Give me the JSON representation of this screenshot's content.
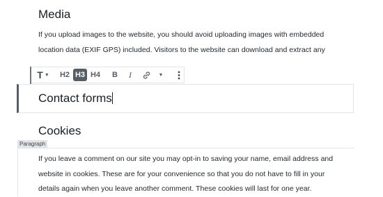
{
  "media": {
    "heading": "Media",
    "lines": [
      "If you upload images to the website, you should avoid uploading images with embedded",
      "location data (EXIF GPS) included. Visitors to the website can download and extract any"
    ]
  },
  "toolbar": {
    "transform_icon": "T",
    "h2": "H2",
    "h3": "H3",
    "h4": "H4",
    "bold": "B",
    "italic": "I"
  },
  "selected_block": {
    "text": "Contact forms"
  },
  "cookies": {
    "heading": "Cookies",
    "block_label": "Paragraph",
    "lines": [
      "If you leave a comment on our site you may opt-in to saving your name, email address and",
      "website in cookies. These are for your convenience so that you do not have to fill in your",
      "details again when you leave another comment. These cookies will last for one year."
    ]
  },
  "icons": [
    "heading-transform-icon",
    "bold-icon",
    "italic-icon",
    "link-icon",
    "chevron-down-icon",
    "more-options-icon"
  ]
}
